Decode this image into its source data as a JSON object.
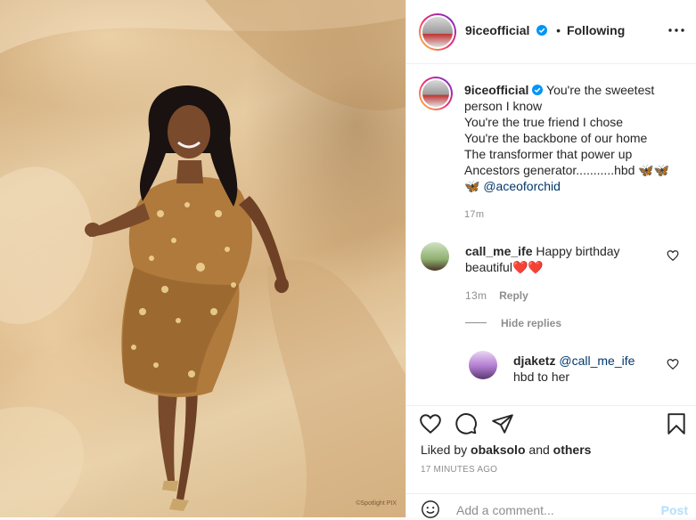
{
  "photo": {
    "watermark": "©Spotlight PIX",
    "colors": {
      "backdrop": "#d6b282",
      "dress": "#b07a3c",
      "skin": "#7a4a2c",
      "hair": "#1a1210"
    }
  },
  "header": {
    "username": "9iceofficial",
    "separator": "•",
    "follow_status": "Following",
    "more_icon": "more-horizontal-icon"
  },
  "caption": {
    "username": "9iceofficial",
    "lines": [
      "You're the sweetest",
      "person I know",
      "You're the true friend I chose",
      "You're the backbone of our home",
      "The transformer that power up",
      "Ancestors generator...........hbd 🦋🦋"
    ],
    "last_line_prefix": "🦋 ",
    "mention": "@aceoforchid",
    "time": "17m"
  },
  "comments": [
    {
      "username": "call_me_ife",
      "text_line1": "Happy birthday",
      "text_line2": "beautiful",
      "emoji": "❤️❤️",
      "time": "13m",
      "reply_label": "Reply"
    }
  ],
  "hide_replies_label": "Hide replies",
  "reply": {
    "username": "djaketz",
    "mention": "@call_me_ife",
    "text": "hbd to her"
  },
  "actions": {
    "icons": [
      "heart-icon",
      "comment-icon",
      "share-icon",
      "bookmark-icon"
    ],
    "likes_prefix": "Liked by ",
    "liked_by_user": "obaksolo",
    "likes_and": " and ",
    "likes_others": "others",
    "timestamp": "17 MINUTES AGO"
  },
  "add_comment": {
    "placeholder": "Add a comment...",
    "post_label": "Post",
    "emoji_icon": "emoji-smile-icon"
  },
  "colors": {
    "link": "#00376b",
    "muted": "#8e8e8e",
    "verified": "#0095f6",
    "post_disabled": "#b2dffc",
    "heart_red": "#e0162b"
  }
}
